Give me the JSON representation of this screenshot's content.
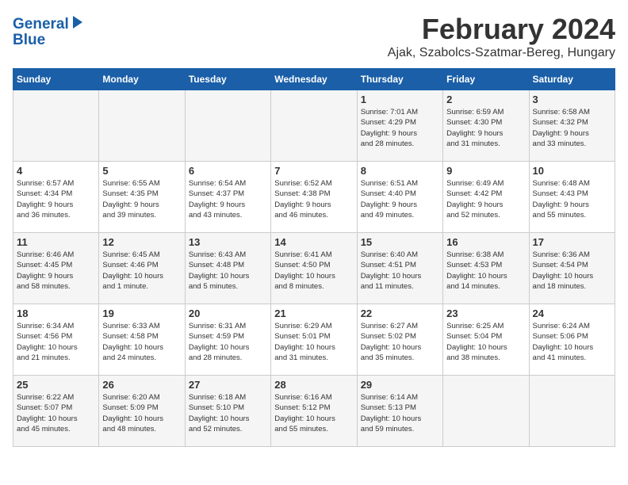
{
  "logo": {
    "line1": "General",
    "line2": "Blue"
  },
  "title": "February 2024",
  "subtitle": "Ajak, Szabolcs-Szatmar-Bereg, Hungary",
  "days_of_week": [
    "Sunday",
    "Monday",
    "Tuesday",
    "Wednesday",
    "Thursday",
    "Friday",
    "Saturday"
  ],
  "weeks": [
    [
      {
        "day": "",
        "detail": ""
      },
      {
        "day": "",
        "detail": ""
      },
      {
        "day": "",
        "detail": ""
      },
      {
        "day": "",
        "detail": ""
      },
      {
        "day": "1",
        "detail": "Sunrise: 7:01 AM\nSunset: 4:29 PM\nDaylight: 9 hours\nand 28 minutes."
      },
      {
        "day": "2",
        "detail": "Sunrise: 6:59 AM\nSunset: 4:30 PM\nDaylight: 9 hours\nand 31 minutes."
      },
      {
        "day": "3",
        "detail": "Sunrise: 6:58 AM\nSunset: 4:32 PM\nDaylight: 9 hours\nand 33 minutes."
      }
    ],
    [
      {
        "day": "4",
        "detail": "Sunrise: 6:57 AM\nSunset: 4:34 PM\nDaylight: 9 hours\nand 36 minutes."
      },
      {
        "day": "5",
        "detail": "Sunrise: 6:55 AM\nSunset: 4:35 PM\nDaylight: 9 hours\nand 39 minutes."
      },
      {
        "day": "6",
        "detail": "Sunrise: 6:54 AM\nSunset: 4:37 PM\nDaylight: 9 hours\nand 43 minutes."
      },
      {
        "day": "7",
        "detail": "Sunrise: 6:52 AM\nSunset: 4:38 PM\nDaylight: 9 hours\nand 46 minutes."
      },
      {
        "day": "8",
        "detail": "Sunrise: 6:51 AM\nSunset: 4:40 PM\nDaylight: 9 hours\nand 49 minutes."
      },
      {
        "day": "9",
        "detail": "Sunrise: 6:49 AM\nSunset: 4:42 PM\nDaylight: 9 hours\nand 52 minutes."
      },
      {
        "day": "10",
        "detail": "Sunrise: 6:48 AM\nSunset: 4:43 PM\nDaylight: 9 hours\nand 55 minutes."
      }
    ],
    [
      {
        "day": "11",
        "detail": "Sunrise: 6:46 AM\nSunset: 4:45 PM\nDaylight: 9 hours\nand 58 minutes."
      },
      {
        "day": "12",
        "detail": "Sunrise: 6:45 AM\nSunset: 4:46 PM\nDaylight: 10 hours\nand 1 minute."
      },
      {
        "day": "13",
        "detail": "Sunrise: 6:43 AM\nSunset: 4:48 PM\nDaylight: 10 hours\nand 5 minutes."
      },
      {
        "day": "14",
        "detail": "Sunrise: 6:41 AM\nSunset: 4:50 PM\nDaylight: 10 hours\nand 8 minutes."
      },
      {
        "day": "15",
        "detail": "Sunrise: 6:40 AM\nSunset: 4:51 PM\nDaylight: 10 hours\nand 11 minutes."
      },
      {
        "day": "16",
        "detail": "Sunrise: 6:38 AM\nSunset: 4:53 PM\nDaylight: 10 hours\nand 14 minutes."
      },
      {
        "day": "17",
        "detail": "Sunrise: 6:36 AM\nSunset: 4:54 PM\nDaylight: 10 hours\nand 18 minutes."
      }
    ],
    [
      {
        "day": "18",
        "detail": "Sunrise: 6:34 AM\nSunset: 4:56 PM\nDaylight: 10 hours\nand 21 minutes."
      },
      {
        "day": "19",
        "detail": "Sunrise: 6:33 AM\nSunset: 4:58 PM\nDaylight: 10 hours\nand 24 minutes."
      },
      {
        "day": "20",
        "detail": "Sunrise: 6:31 AM\nSunset: 4:59 PM\nDaylight: 10 hours\nand 28 minutes."
      },
      {
        "day": "21",
        "detail": "Sunrise: 6:29 AM\nSunset: 5:01 PM\nDaylight: 10 hours\nand 31 minutes."
      },
      {
        "day": "22",
        "detail": "Sunrise: 6:27 AM\nSunset: 5:02 PM\nDaylight: 10 hours\nand 35 minutes."
      },
      {
        "day": "23",
        "detail": "Sunrise: 6:25 AM\nSunset: 5:04 PM\nDaylight: 10 hours\nand 38 minutes."
      },
      {
        "day": "24",
        "detail": "Sunrise: 6:24 AM\nSunset: 5:06 PM\nDaylight: 10 hours\nand 41 minutes."
      }
    ],
    [
      {
        "day": "25",
        "detail": "Sunrise: 6:22 AM\nSunset: 5:07 PM\nDaylight: 10 hours\nand 45 minutes."
      },
      {
        "day": "26",
        "detail": "Sunrise: 6:20 AM\nSunset: 5:09 PM\nDaylight: 10 hours\nand 48 minutes."
      },
      {
        "day": "27",
        "detail": "Sunrise: 6:18 AM\nSunset: 5:10 PM\nDaylight: 10 hours\nand 52 minutes."
      },
      {
        "day": "28",
        "detail": "Sunrise: 6:16 AM\nSunset: 5:12 PM\nDaylight: 10 hours\nand 55 minutes."
      },
      {
        "day": "29",
        "detail": "Sunrise: 6:14 AM\nSunset: 5:13 PM\nDaylight: 10 hours\nand 59 minutes."
      },
      {
        "day": "",
        "detail": ""
      },
      {
        "day": "",
        "detail": ""
      }
    ]
  ]
}
